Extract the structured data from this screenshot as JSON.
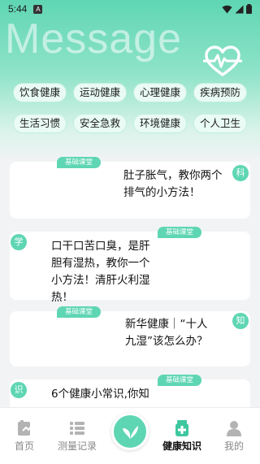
{
  "status": {
    "time": "5:44",
    "a_icon": "A"
  },
  "banner": {
    "title": "Message"
  },
  "tags": [
    "饮食健康",
    "运动健康",
    "心理健康",
    "疾病预防",
    "生活习惯",
    "安全急救",
    "环境健康",
    "个人卫生"
  ],
  "cards": [
    {
      "badge": "基础课堂",
      "corner": "科",
      "text": "肚子胀气，教你两个排气的小方法！"
    },
    {
      "badge": "基础课堂",
      "corner": "学",
      "text": "口干口苦口臭，是肝胆有湿热，教你一个小方法！清肝火利湿热！"
    },
    {
      "badge": "基础课堂",
      "corner": "知",
      "text": "新华健康｜“十人九湿”该怎么办？"
    },
    {
      "badge": "基础课堂",
      "corner": "识",
      "text": "6个健康小常识,你知"
    }
  ],
  "tabbar": {
    "home": "首页",
    "records": "测量记录",
    "knowledge": "健康知识",
    "mine": "我的"
  },
  "colors": {
    "accent": "#5fd6b3",
    "tag_bg": "#e9fbf4"
  }
}
